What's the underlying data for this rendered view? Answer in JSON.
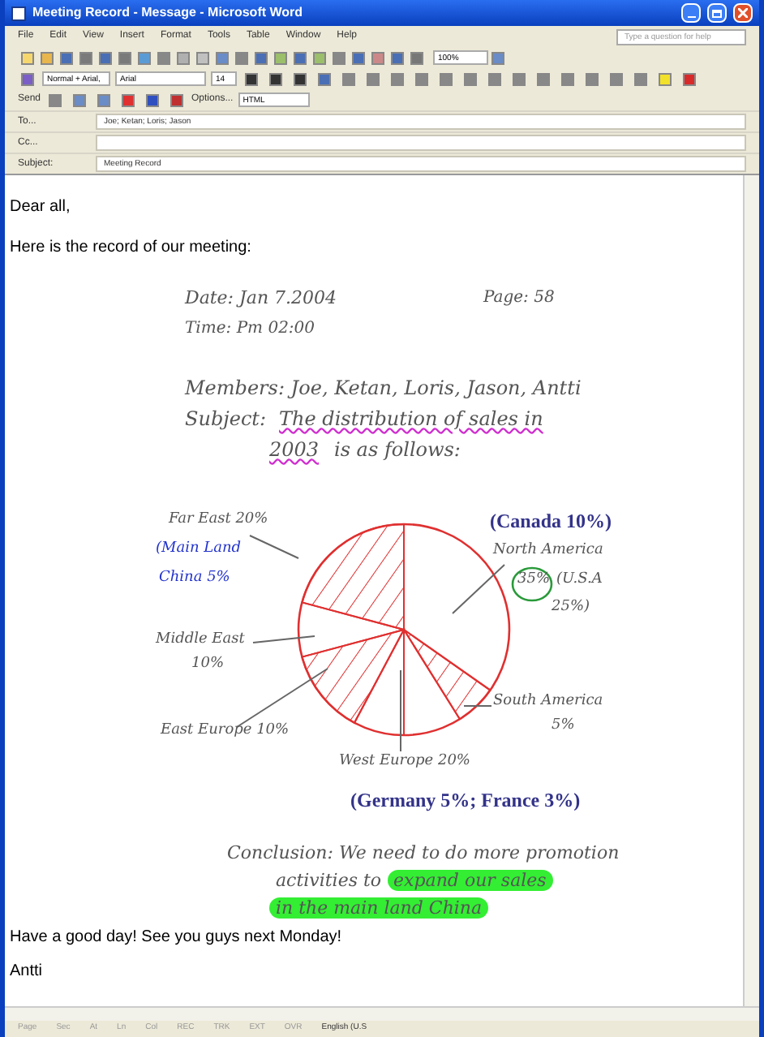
{
  "window": {
    "title": "Meeting Record - Message - Microsoft Word"
  },
  "menu": [
    "File",
    "Edit",
    "View",
    "Insert",
    "Format",
    "Tools",
    "Table",
    "Window",
    "Help"
  ],
  "help_box": {
    "placeholder": "Type a question for help"
  },
  "standard_toolbar": {
    "zoom": "100%"
  },
  "formatting_toolbar": {
    "style": "Normal + Arial, ",
    "font": "Arial",
    "size": "14"
  },
  "email_toolbar": {
    "send": "Send",
    "options": "Options...",
    "format": "HTML"
  },
  "header_fields": [
    {
      "label": "To...",
      "value": "Joe; Ketan; Loris; Jason"
    },
    {
      "label": "Cc..."
    },
    {
      "label": "Subject:",
      "value": "Meeting Record"
    }
  ],
  "body": {
    "greeting": "Dear all,",
    "intro": "Here is the record of our meeting:",
    "note": {
      "date": "Date: Jan 7.2004",
      "page": "Page: 58",
      "time": "Time: Pm 02:00",
      "members": "Members: Joe, Ketan, Loris, Jason, Antti",
      "subject_label": "Subject:",
      "subject_line_1": "The distribution of sales in",
      "subject_line_2_underlined": "2003",
      "subject_line_2_rest": "is as follows:",
      "chart_labels": [
        {
          "text": "Far East 20%",
          "color": "#555555"
        },
        {
          "text": "(Canada 10%)",
          "color": "#33338a"
        },
        {
          "text": "(Main Land",
          "color": "#2233cc"
        },
        {
          "text": "North America",
          "color": "#555555"
        },
        {
          "text": "China 5%",
          "color": "#2233cc"
        },
        {
          "text": "35%",
          "color": "#555555"
        },
        {
          "text": "(U.S.A",
          "color": "#555555"
        },
        {
          "text": "25%)",
          "color": "#555555"
        },
        {
          "text": "Middle East",
          "color": "#555555"
        },
        {
          "text": "10%",
          "color": "#555555"
        },
        {
          "text": "South America",
          "color": "#555555"
        },
        {
          "text": "5%",
          "color": "#555555"
        },
        {
          "text": "East Europe 10%",
          "color": "#555555"
        },
        {
          "text": "West Europe 20%",
          "color": "#555555"
        },
        {
          "text": "(Germany 5%; France 3%)",
          "color": "#33338a"
        }
      ],
      "conclusion": [
        [
          {
            "text": "Conclusion: We need to do more promotion",
            "highlighted": false
          }
        ],
        [
          {
            "text": "activities to ",
            "highlighted": false
          },
          {
            "text": "expand our sales",
            "highlighted": true
          }
        ],
        [
          {
            "text": "in the main land China",
            "highlighted": true
          }
        ]
      ]
    },
    "closing": "Have a good day! See you guys next Monday!",
    "signature": "Antti"
  },
  "status_bar": [
    "Page",
    "Sec",
    "At",
    "Ln",
    "Col",
    "REC",
    "TRK",
    "EXT",
    "OVR",
    "English (U.S"
  ]
}
